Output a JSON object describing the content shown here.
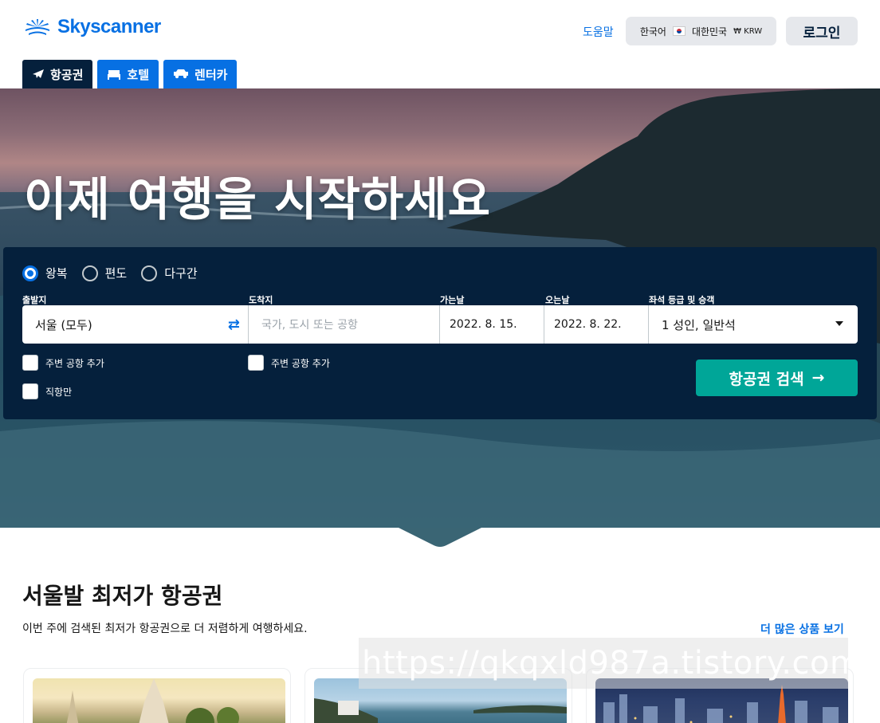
{
  "header": {
    "logo_text": "Skyscanner",
    "help_label": "도움말",
    "locale": {
      "language": "한국어",
      "region": "대한민국",
      "currency": "₩ KRW"
    },
    "login_label": "로그인"
  },
  "tabs": [
    {
      "label": "항공권",
      "icon": "plane-icon",
      "active": true
    },
    {
      "label": "호텔",
      "icon": "bed-icon",
      "active": false
    },
    {
      "label": "렌터카",
      "icon": "car-icon",
      "active": false
    }
  ],
  "hero": {
    "title": "이제 여행을 시작하세요"
  },
  "search": {
    "trip_types": [
      {
        "label": "왕복",
        "selected": true
      },
      {
        "label": "편도",
        "selected": false
      },
      {
        "label": "다구간",
        "selected": false
      }
    ],
    "labels": {
      "origin": "출발지",
      "destination": "도착지",
      "depart": "가는날",
      "return": "오는날",
      "cabin": "좌석 등급 및 승객"
    },
    "origin_value": "서울 (모두)",
    "destination_placeholder": "국가, 도시 또는 공항",
    "depart_value": "2022. 8. 15.",
    "return_value": "2022. 8. 22.",
    "cabin_value": "1 성인, 일반석",
    "nearby_origin": "주변 공항 추가",
    "nearby_destination": "주변 공항 추가",
    "direct_only": "직항만",
    "search_button": "항공권 검색"
  },
  "deals": {
    "title": "서울발 최저가 항공권",
    "subtitle": "이번 주에 검색된 최저가 항공권으로 더 저렴하게 여행하세요.",
    "more_label": "더 많은 상품 보기"
  },
  "watermark": "https://qkqxld987a.tistory.com",
  "colors": {
    "brand": "#0770e3",
    "navy": "#05203c",
    "search": "#00a698"
  }
}
